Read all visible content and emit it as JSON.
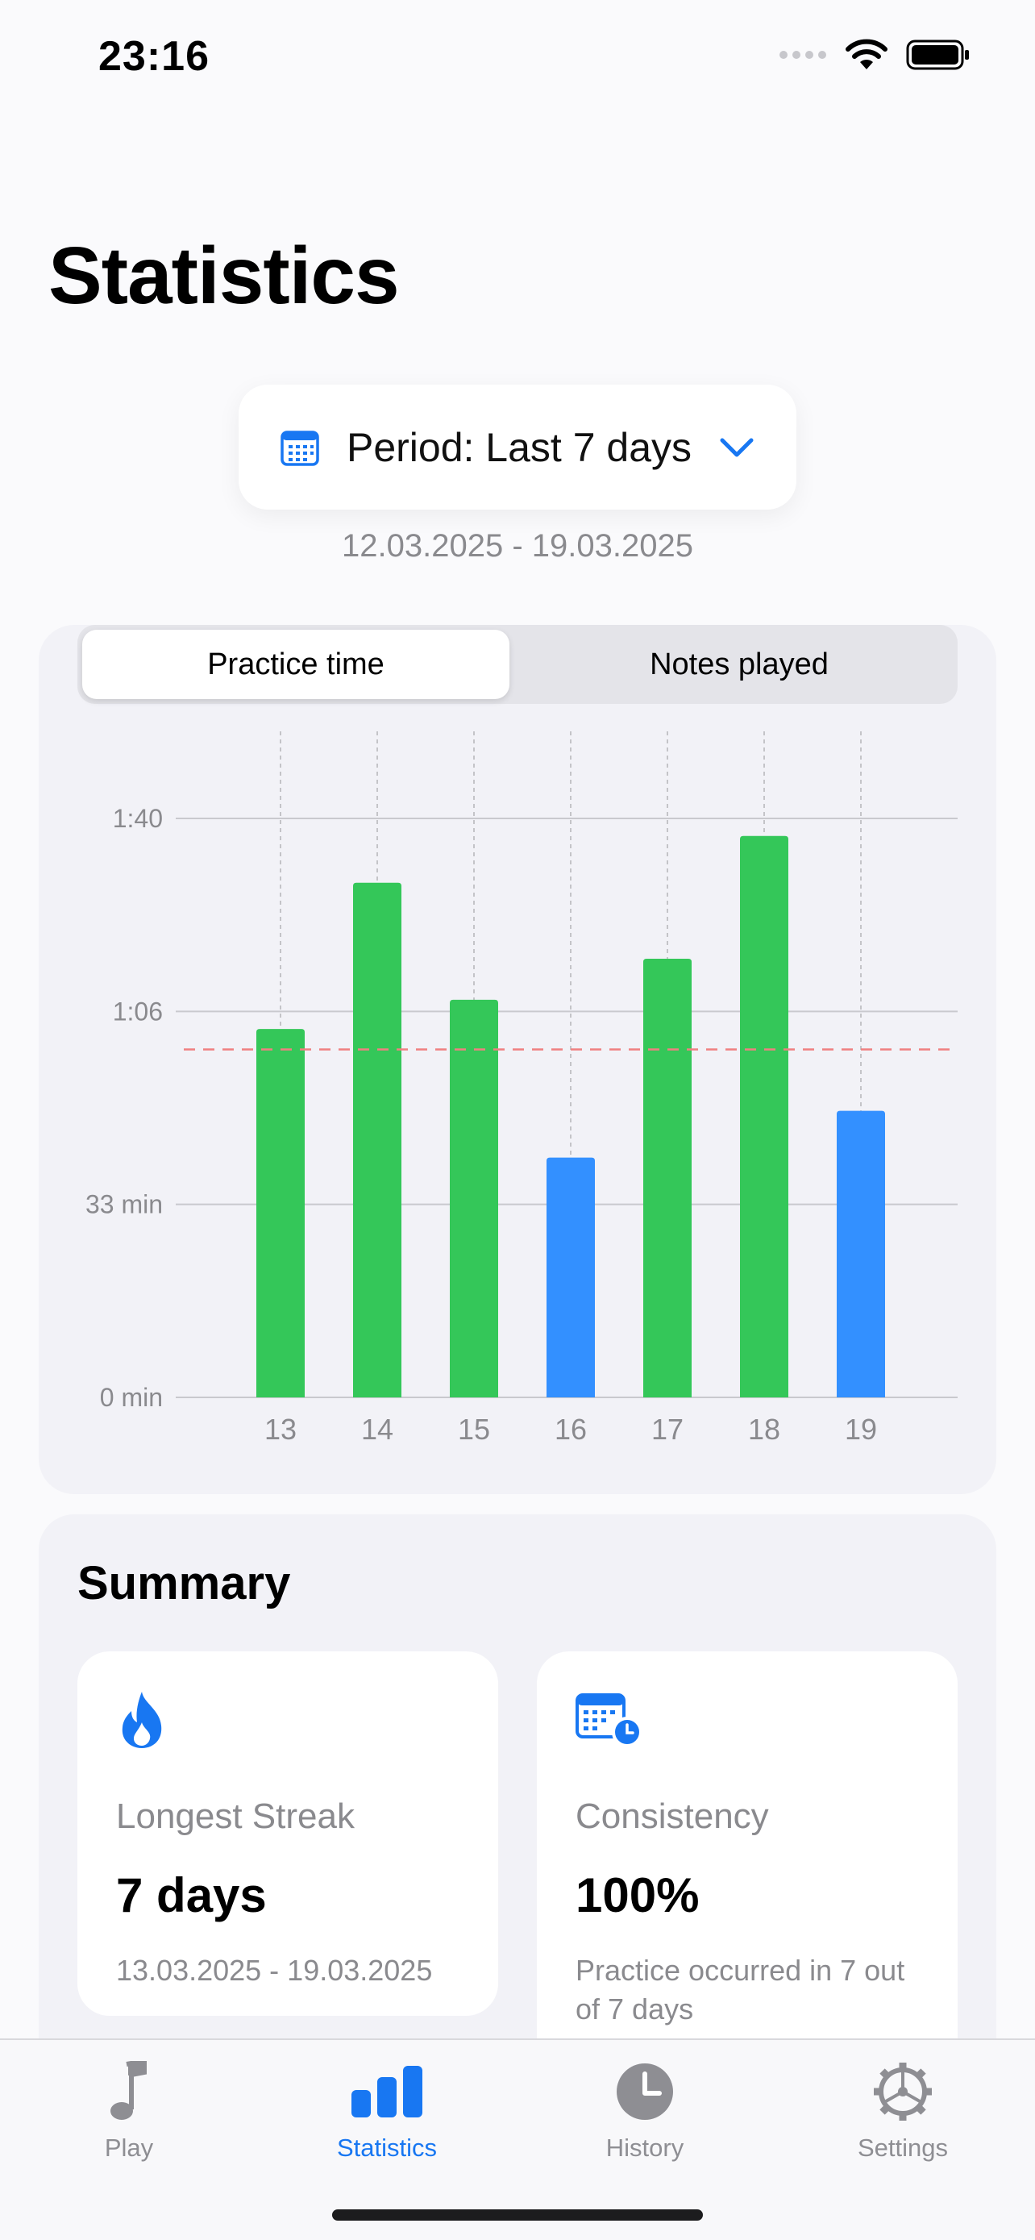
{
  "status_bar": {
    "time": "23:16"
  },
  "page": {
    "title": "Statistics"
  },
  "period": {
    "label": "Period: Last 7 days",
    "date_range": "12.03.2025 - 19.03.2025"
  },
  "segmented": {
    "options": [
      "Practice time",
      "Notes played"
    ],
    "selected": "Practice time"
  },
  "chart_data": {
    "type": "bar",
    "categories": [
      "13",
      "14",
      "15",
      "16",
      "17",
      "18",
      "19"
    ],
    "values": [
      63,
      88,
      68,
      41,
      75,
      96,
      49
    ],
    "value_units": "minutes",
    "colors": [
      "#34c759",
      "#34c759",
      "#34c759",
      "#3390ff",
      "#34c759",
      "#34c759",
      "#3390ff"
    ],
    "y_ticks": [
      {
        "value": 0,
        "label": "0 min"
      },
      {
        "value": 33,
        "label": "33 min"
      },
      {
        "value": 66,
        "label": "1:06"
      },
      {
        "value": 99,
        "label": "1:40"
      }
    ],
    "ylim": [
      0,
      99
    ],
    "reference_line": {
      "value": 59.5,
      "style": "dashed",
      "color": "#f08080"
    },
    "grid": true
  },
  "summary": {
    "title": "Summary",
    "longest_streak": {
      "label": "Longest Streak",
      "value": "7 days",
      "sub": "13.03.2025 - 19.03.2025",
      "icon": "flame-icon"
    },
    "consistency": {
      "label": "Consistency",
      "value": "100%",
      "sub": "Practice occurred in 7 out of 7 days",
      "icon": "calendar-clock-icon"
    }
  },
  "tabs": [
    {
      "label": "Play",
      "icon": "music-note-icon",
      "active": false
    },
    {
      "label": "Statistics",
      "icon": "chart-bar-icon",
      "active": true
    },
    {
      "label": "History",
      "icon": "clock-icon",
      "active": false
    },
    {
      "label": "Settings",
      "icon": "gear-icon",
      "active": false
    }
  ],
  "colors": {
    "accent": "#1877f2",
    "bar_green": "#34c759",
    "bar_blue": "#3390ff"
  }
}
